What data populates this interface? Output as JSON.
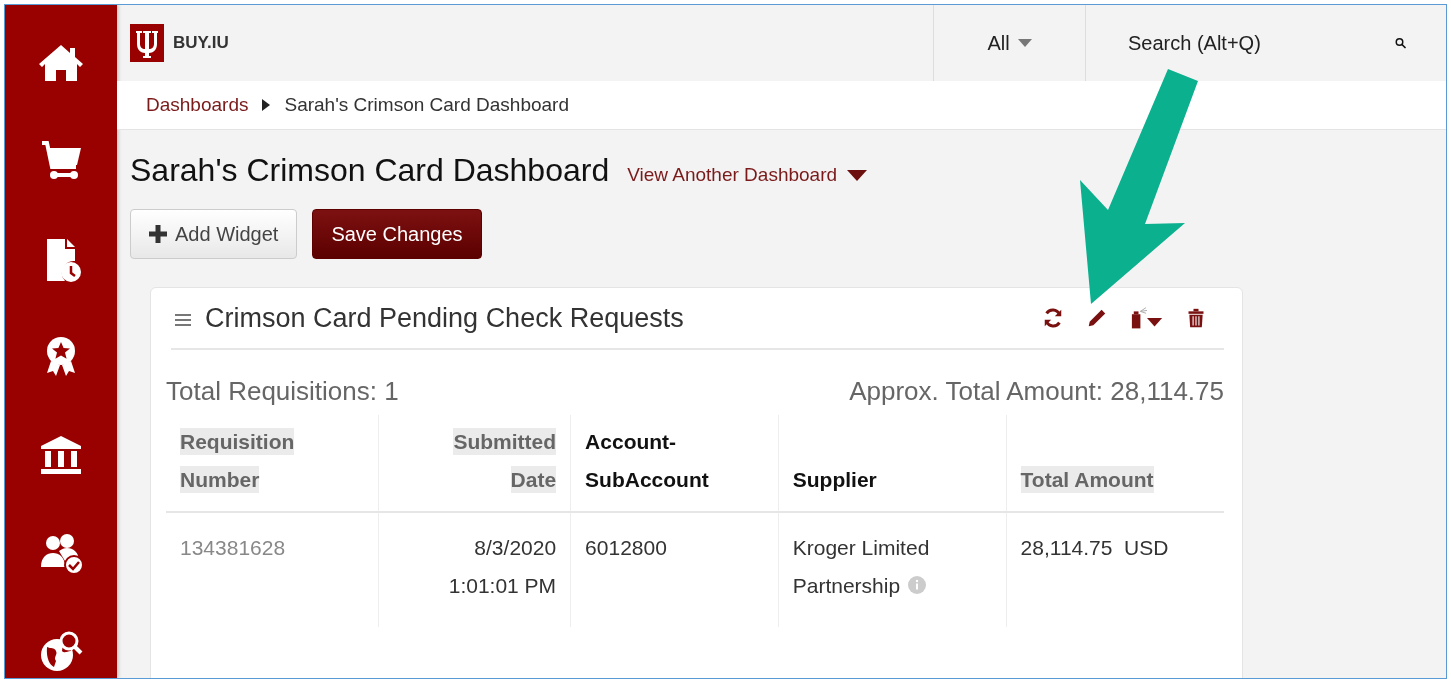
{
  "sidebar": {
    "items": [
      {
        "kind": "home"
      },
      {
        "kind": "cart"
      },
      {
        "kind": "document"
      },
      {
        "kind": "award"
      },
      {
        "kind": "bank"
      },
      {
        "kind": "users"
      },
      {
        "kind": "globe"
      }
    ]
  },
  "brand": {
    "name": "BUY.IU"
  },
  "search": {
    "scope": "All",
    "placeholder": "Search (Alt+Q)"
  },
  "breadcrumb": [
    {
      "label": "Dashboards",
      "kind": "link"
    },
    {
      "label": "Sarah's Crimson Card Dashboard",
      "kind": "current"
    }
  ],
  "page": {
    "title": "Sarah's Crimson Card Dashboard",
    "switcher": "View Another Dashboard"
  },
  "actions": [
    {
      "label": "Add Widget",
      "kind": "secondary"
    },
    {
      "label": "Save Changes",
      "kind": "primary"
    }
  ],
  "widget": {
    "title": "Crimson Card Pending Check Requests",
    "tools": [
      {
        "kind": "refresh"
      },
      {
        "kind": "edit"
      },
      {
        "kind": "style"
      },
      {
        "kind": "delete"
      }
    ],
    "summary_left": "Total Requisitions: 1",
    "summary_right": "Approx. Total Amount: 28,114.75",
    "table": {
      "columns": [
        {
          "label": "Requisition Number",
          "sortable": true
        },
        {
          "label": "Submitted Date",
          "sortable": true
        },
        {
          "label": "Account-SubAccount",
          "sortable": false
        },
        {
          "label": "Supplier",
          "sortable": false
        },
        {
          "label": "Total Amount",
          "sortable": true
        }
      ],
      "rows": [
        {
          "cells": [
            {
              "text": "134381628",
              "muted": true
            },
            {
              "text": "8/3/2020 1:01:01 PM",
              "muted": false
            },
            {
              "text": "6012800",
              "muted": false
            },
            {
              "text": "Kroger Limited Partnership",
              "muted": false,
              "info": true
            },
            {
              "text": "28,114.75  USD",
              "muted": false
            }
          ]
        }
      ]
    }
  }
}
